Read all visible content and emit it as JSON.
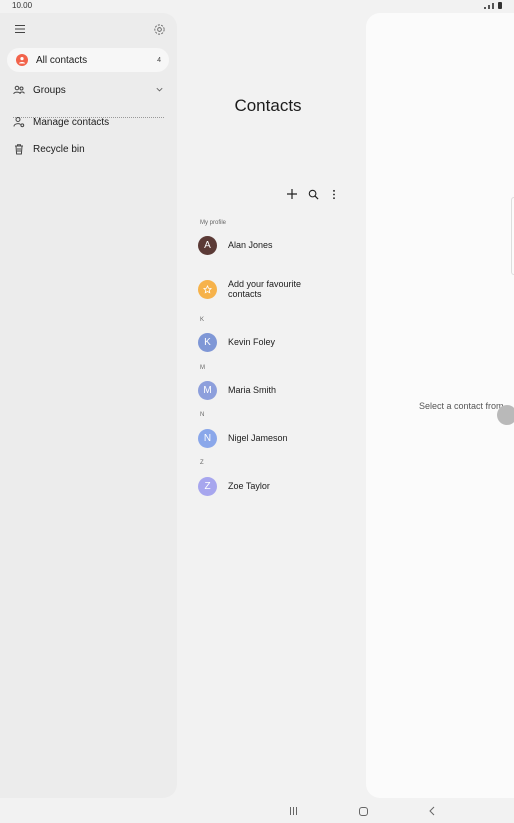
{
  "status_bar": {
    "time": "10.00"
  },
  "drawer": {
    "all_contacts": {
      "label": "All contacts",
      "count": "4"
    },
    "groups_label": "Groups",
    "manage_contacts_label": "Manage contacts",
    "recycle_bin_label": "Recycle bin"
  },
  "contacts": {
    "title": "Contacts",
    "my_profile_section": "My profile",
    "profile": {
      "initial": "A",
      "name": "Alan Jones",
      "color": "#5b3a36"
    },
    "favourites": {
      "line1": "Add your favourite",
      "line2": "contacts",
      "color": "#f6b24a"
    },
    "groups": [
      {
        "letter": "K",
        "initial": "K",
        "name": "Kevin Foley",
        "color": "#7f97d6"
      },
      {
        "letter": "M",
        "initial": "M",
        "name": "Maria Smith",
        "color": "#8d9fdc"
      },
      {
        "letter": "N",
        "initial": "N",
        "name": "Nigel Jameson",
        "color": "#8aa7ea"
      },
      {
        "letter": "Z",
        "initial": "Z",
        "name": "Zoe Taylor",
        "color": "#a7a6ee"
      }
    ]
  },
  "detail": {
    "hint": "Select a contact from"
  },
  "colors": {
    "accent_badge": "#f2634b"
  },
  "icons": [
    "menu-icon",
    "gear-icon",
    "person-icon",
    "groups-icon",
    "chevron-down-icon",
    "manage-contacts-icon",
    "trash-icon",
    "plus-icon",
    "search-icon",
    "more-vert-icon",
    "star-icon",
    "recents-icon",
    "home-icon",
    "back-icon"
  ]
}
